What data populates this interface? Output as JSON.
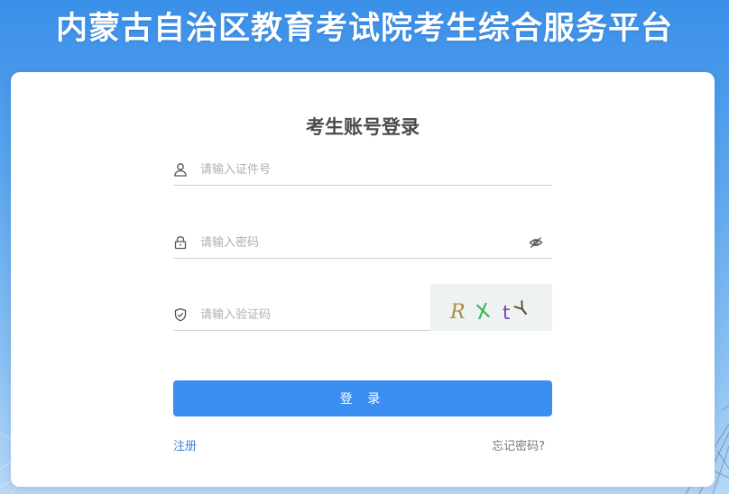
{
  "site": {
    "title": "内蒙古自治区教育考试院考生综合服务平台"
  },
  "login": {
    "title": "考生账号登录",
    "id_placeholder": "请输入证件号",
    "password_placeholder": "请输入密码",
    "captcha_placeholder": "请输入验证码",
    "captcha_chars": [
      "R",
      "X",
      "t",
      "Y"
    ],
    "captcha_colors": [
      "#b08a3c",
      "#2fb34a",
      "#7a3fb8",
      "#5a4a2e"
    ],
    "submit_label": "登 录",
    "register_label": "注册",
    "forgot_label": "忘记密码?"
  },
  "colors": {
    "primary": "#3b8ef0",
    "link": "#3b7fd4"
  },
  "icons": {
    "id": "user-icon",
    "password": "lock-icon",
    "captcha": "shield-icon",
    "visibility": "eye-off-icon"
  }
}
